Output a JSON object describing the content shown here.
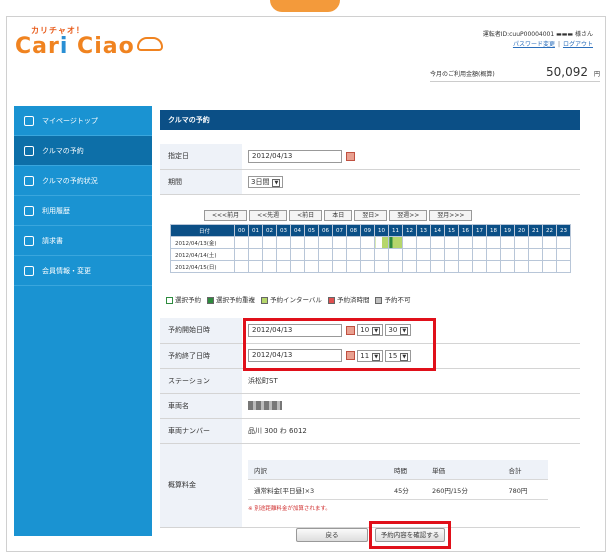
{
  "brand": {
    "sub": "カリチャオ！",
    "name_a": "Car",
    "name_b": "i",
    "name_c": " Ciao"
  },
  "user": {
    "line": "運転者ID:cuuP00004001 ▬▬▬ 様さん",
    "password_link": "パスワード変更",
    "logout_link": "ログアウト",
    "sep": "|"
  },
  "usage": {
    "label": "今月のご利用金額(概算)",
    "value": "50,092",
    "unit": "円"
  },
  "sidebar": {
    "items": [
      {
        "label": "マイページトップ",
        "icon": "house-icon"
      },
      {
        "label": "クルマの予約",
        "icon": "calendar-icon"
      },
      {
        "label": "クルマの予約状況",
        "icon": "car-icon"
      },
      {
        "label": "利用履歴",
        "icon": "list-icon"
      },
      {
        "label": "請求書",
        "icon": "document-icon"
      },
      {
        "label": "会員情報・変更",
        "icon": "id-card-icon"
      }
    ],
    "active_index": 1
  },
  "main": {
    "title": "クルマの予約",
    "date_label": "指定日",
    "date_value": "2012/04/13",
    "period_label": "期間",
    "period_value": "3日間",
    "nav": [
      "<<<前月",
      "<<先週",
      "<前日",
      "本日",
      "翌日>",
      "翌週>>",
      "翌月>>>"
    ],
    "grid_header": "日付",
    "hours": [
      "00",
      "01",
      "02",
      "03",
      "04",
      "05",
      "06",
      "07",
      "08",
      "09",
      "10",
      "11",
      "12",
      "13",
      "14",
      "15",
      "16",
      "17",
      "18",
      "19",
      "20",
      "21",
      "22",
      "23"
    ],
    "days": [
      "2012/04/13(金)",
      "2012/04/14(土)",
      "2012/04/15(日)"
    ],
    "legend": [
      {
        "label": "選択予約",
        "color": "#ffffff"
      },
      {
        "label": "選択予約重複",
        "color": "#2e8b3e"
      },
      {
        "label": "予約インターバル",
        "color": "#b5d66b"
      },
      {
        "label": "予約済時間",
        "color": "#e05050"
      },
      {
        "label": "予約不可",
        "color": "#c0c0c0"
      }
    ],
    "start_label": "予約開始日時",
    "start_date": "2012/04/13",
    "start_hour": "10",
    "start_min": "30",
    "end_label": "予約終了日時",
    "end_date": "2012/04/13",
    "end_hour": "11",
    "end_min": "15",
    "station_label": "ステーション",
    "station_value": "浜松町ST",
    "car_label": "車両名",
    "plate_label": "車両ナンバー",
    "plate_value": "品川 300 わ 6012",
    "fee_label": "概算料金",
    "fee_head": [
      "内訳",
      "時間",
      "単価",
      "合計"
    ],
    "fee_row": [
      "通常料金[平日昼]×3",
      "45分",
      "260円/15分",
      "780円"
    ],
    "fee_note": "※ 別途距離料金が加算されます。",
    "back_button": "戻る",
    "confirm_button": "予約内容を確認する"
  }
}
